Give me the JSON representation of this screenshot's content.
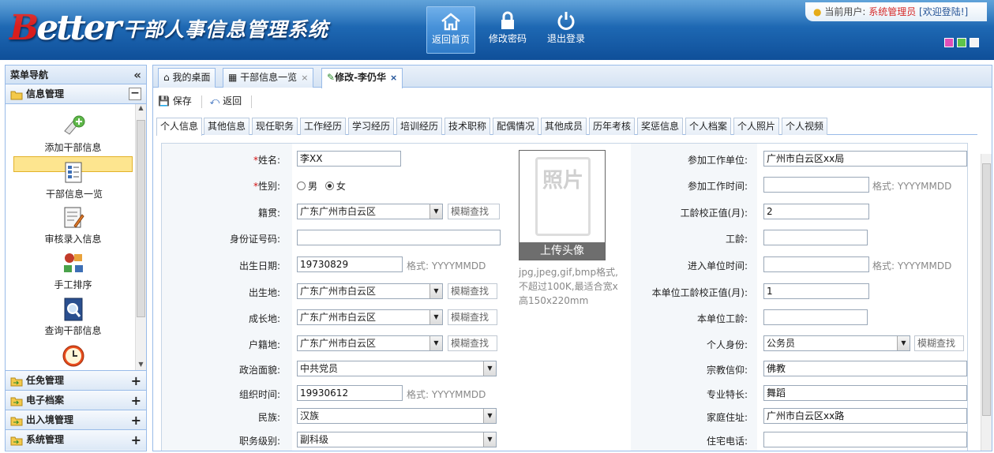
{
  "header": {
    "logo_text": "Better",
    "system_title": "干部人事信息管理系统",
    "buttons": [
      {
        "label": "返回首页",
        "icon": "home-icon"
      },
      {
        "label": "修改密码",
        "icon": "lock-icon"
      },
      {
        "label": "退出登录",
        "icon": "power-icon"
      }
    ],
    "user": {
      "label": "当前用户:",
      "name": "系统管理员",
      "welcome": "[欢迎登陆!]"
    },
    "skin_colors": [
      "#e04fb8",
      "#5ec44a",
      "#ffffff"
    ]
  },
  "sidebar": {
    "title": "菜单导航",
    "collapse_icon": "«",
    "groups": [
      {
        "label": "信息管理",
        "toggle": "−"
      },
      {
        "label": "任免管理",
        "toggle": "+"
      },
      {
        "label": "电子档案",
        "toggle": "+"
      },
      {
        "label": "出入境管理",
        "toggle": "+"
      },
      {
        "label": "系统管理",
        "toggle": "+"
      }
    ],
    "items": [
      {
        "label": "添加干部信息",
        "icon": "add-doc-icon"
      },
      {
        "label": "干部信息一览",
        "icon": "list-view-icon"
      },
      {
        "label": "审核录入信息",
        "icon": "edit-doc-icon"
      },
      {
        "label": "手工排序",
        "icon": "sort-icon"
      },
      {
        "label": "查询干部信息",
        "icon": "search-book-icon"
      },
      {
        "label": "",
        "icon": "alarm-clock-icon"
      }
    ]
  },
  "page_tabs": [
    {
      "label": "我的桌面",
      "close": ""
    },
    {
      "label": "干部信息一览",
      "close": "×"
    },
    {
      "label": "修改-李仍华",
      "close": "×"
    }
  ],
  "toolbar": {
    "save": "保存",
    "back": "返回"
  },
  "sub_tabs": [
    "个人信息",
    "其他信息",
    "现任职务",
    "工作经历",
    "学习经历",
    "培训经历",
    "技术职称",
    "配偶情况",
    "其他成员",
    "历年考核",
    "奖惩信息",
    "个人档案",
    "个人照片",
    "个人视频"
  ],
  "form": {
    "name": {
      "label": "姓名:",
      "req": "*",
      "value": "李XX"
    },
    "gender": {
      "label": "性别:",
      "req": "*",
      "male": "男",
      "female": "女",
      "selected": "女"
    },
    "native": {
      "label": "籍贯:",
      "value": "广东广州市白云区",
      "fuzzy": "模糊查找"
    },
    "idcard": {
      "label": "身份证号码:",
      "value": ""
    },
    "birth": {
      "label": "出生日期:",
      "value": "19730829",
      "fmt": "格式: YYYYMMDD"
    },
    "birthplace": {
      "label": "出生地:",
      "value": "广东广州市白云区",
      "fuzzy": "模糊查找"
    },
    "growplace": {
      "label": "成长地:",
      "value": "广东广州市白云区",
      "fuzzy": "模糊查找"
    },
    "household": {
      "label": "户籍地:",
      "value": "广东广州市白云区",
      "fuzzy": "模糊查找"
    },
    "politics": {
      "label": "政治面貌:",
      "value": "中共党员"
    },
    "org_time": {
      "label": "组织时间:",
      "value": "19930612",
      "fmt": "格式: YYYYMMDD"
    },
    "nation": {
      "label": "民族:",
      "value": "汉族"
    },
    "rank": {
      "label": "职务级别:",
      "value": "副科级"
    },
    "photo": {
      "placeholder": "照片",
      "upload": "上传头像",
      "hint": "jpg,jpeg,gif,bmp格式,不超过100K,最适合宽x高150x220mm"
    },
    "work_unit": {
      "label": "参加工作单位:",
      "value": "广州市白云区xx局"
    },
    "work_time": {
      "label": "参加工作时间:",
      "value": "",
      "fmt": "格式: YYYYMMDD"
    },
    "seniority_adj": {
      "label": "工龄校正值(月):",
      "value": "2"
    },
    "seniority": {
      "label": "工龄:",
      "value": ""
    },
    "enter_time": {
      "label": "进入单位时间:",
      "value": "",
      "fmt": "格式: YYYYMMDD"
    },
    "unit_seniority_adj": {
      "label": "本单位工龄校正值(月):",
      "value": "1"
    },
    "unit_seniority": {
      "label": "本单位工龄:",
      "value": ""
    },
    "identity": {
      "label": "个人身份:",
      "value": "公务员",
      "fuzzy": "模糊查找"
    },
    "religion": {
      "label": "宗教信仰:",
      "value": "佛教"
    },
    "specialty": {
      "label": "专业特长:",
      "value": "舞蹈"
    },
    "address": {
      "label": "家庭住址:",
      "value": "广州市白云区xx路"
    },
    "phone": {
      "label": "住宅电话:",
      "value": ""
    }
  }
}
